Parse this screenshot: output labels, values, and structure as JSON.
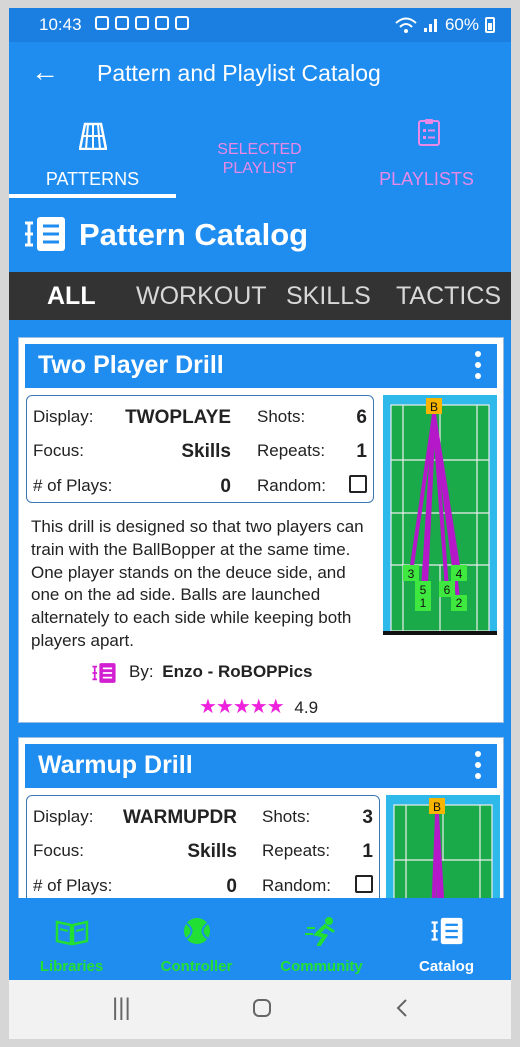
{
  "status": {
    "time": "10:43",
    "battery": "60%"
  },
  "appbar": {
    "title": "Pattern and Playlist Catalog"
  },
  "tabs": [
    {
      "label": "PATTERNS",
      "icon": "court-icon",
      "active": true
    },
    {
      "label_line1": "SELECTED",
      "label_line2": "PLAYLIST"
    },
    {
      "label": "PLAYLISTS",
      "icon": "clipboard-icon"
    }
  ],
  "catalog": {
    "title": "Pattern Catalog"
  },
  "filters": [
    "ALL",
    "WORKOUT",
    "SKILLS",
    "TACTICS"
  ],
  "labels": {
    "display": "Display:",
    "focus": "Focus:",
    "plays": "# of Plays:",
    "shots": "Shots:",
    "repeats": "Repeats:",
    "random": "Random:",
    "by": "By:"
  },
  "cards": [
    {
      "name": "Two Player Drill",
      "display": "TWOPLAYE",
      "focus": "Skills",
      "plays": "0",
      "shots": "6",
      "repeats": "1",
      "random": false,
      "description": "This drill is designed so that two players can train with the BallBopper at the same time. One player stands on the deuce side, and one on the ad side. Balls are launched alternately to each side while keeping both players apart.",
      "author": "Enzo - RoBOPPics",
      "stars": "★★★★★",
      "rating": "4.9",
      "court_start": "B",
      "court_markers": [
        "3",
        "5",
        "1",
        "6",
        "4",
        "2"
      ]
    },
    {
      "name": "Warmup Drill",
      "display": "WARMUPDR",
      "focus": "Skills",
      "plays": "0",
      "shots": "3",
      "repeats": "1",
      "random": false,
      "court_start": "B"
    }
  ],
  "bottomnav": [
    {
      "label": "Libraries",
      "icon": "book-icon"
    },
    {
      "label": "Controller",
      "icon": "ball-icon"
    },
    {
      "label": "Community",
      "icon": "runner-icon"
    },
    {
      "label": "Catalog",
      "icon": "catalog-icon",
      "active": true
    }
  ],
  "colors": {
    "primary": "#1f8cf0",
    "accent_pink": "#e889e8",
    "nav_green": "#22e033",
    "court_green": "#1aaa4a",
    "path_purple": "#b418c8",
    "star_pink": "#ee22dd"
  }
}
